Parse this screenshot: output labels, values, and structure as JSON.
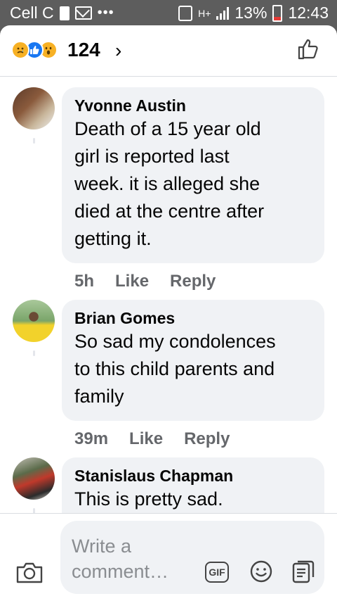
{
  "status_bar": {
    "carrier": "Cell C",
    "dots": "•••",
    "network": "H+",
    "battery": "13%",
    "time": "12:43"
  },
  "header": {
    "reaction_count": "124",
    "chevron": "›",
    "reactions": [
      "sad-reaction-icon",
      "like-reaction-icon",
      "wow-reaction-icon"
    ]
  },
  "comments": [
    {
      "name": "Yvonne Austin",
      "lines": [
        "Death of a 15 year old",
        "girl is reported last",
        "week. it is alleged she",
        "died at the centre after",
        "getting it."
      ],
      "time": "5h",
      "like": "Like",
      "reply": "Reply"
    },
    {
      "name": "Brian Gomes",
      "lines": [
        "So sad my condolences",
        "to this child parents and",
        "family"
      ],
      "time": "39m",
      "like": "Like",
      "reply": "Reply"
    },
    {
      "name": "Stanislaus Chapman",
      "lines": [
        "This is pretty sad."
      ]
    }
  ],
  "composer": {
    "placeholder": "Write a comment…",
    "gif_label": "GIF"
  },
  "colors": {
    "status_bar_bg": "#5d5d5d",
    "bubble_bg": "#f0f2f5",
    "secondary_text": "#65676b",
    "like_blue": "#1877f2",
    "reaction_yellow": "#f7b125",
    "battery_low": "#e53935"
  }
}
